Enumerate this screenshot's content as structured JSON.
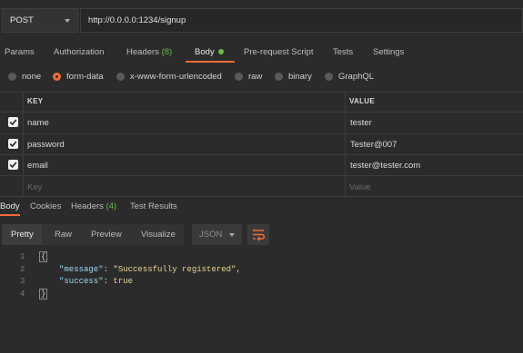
{
  "request": {
    "method": "POST",
    "url": "http://0.0.0.0:1234/signup"
  },
  "tabs": [
    {
      "label": "Params"
    },
    {
      "label": "Authorization"
    },
    {
      "label": "Headers",
      "count": "(8)"
    },
    {
      "label": "Body"
    },
    {
      "label": "Pre-request Script"
    },
    {
      "label": "Tests"
    },
    {
      "label": "Settings"
    }
  ],
  "body_modes": [
    {
      "label": "none",
      "selected": false
    },
    {
      "label": "form-data",
      "selected": true
    },
    {
      "label": "x-www-form-urlencoded",
      "selected": false
    },
    {
      "label": "raw",
      "selected": false
    },
    {
      "label": "binary",
      "selected": false
    },
    {
      "label": "GraphQL",
      "selected": false
    }
  ],
  "table": {
    "headers": {
      "key": "KEY",
      "value": "VALUE"
    },
    "rows": [
      {
        "key": "name",
        "value": "tester",
        "checked": true
      },
      {
        "key": "password",
        "value": "Tester@007",
        "checked": true
      },
      {
        "key": "email",
        "value": "tester@tester.com",
        "checked": true
      }
    ],
    "placeholder": {
      "key": "Key",
      "value": "Value"
    }
  },
  "response_tabs": [
    {
      "label": "Body"
    },
    {
      "label": "Cookies"
    },
    {
      "label": "Headers",
      "count": "(4)"
    },
    {
      "label": "Test Results"
    }
  ],
  "view_modes": [
    "Pretty",
    "Raw",
    "Preview",
    "Visualize"
  ],
  "format": "JSON",
  "code": {
    "line_numbers": [
      "1",
      "2",
      "3",
      "4"
    ],
    "open_brace": "{",
    "close_brace": "}",
    "message_key": "\"message\"",
    "message_value": "\"Successfully registered\"",
    "success_key": "\"success\"",
    "success_value": "true"
  },
  "colors": {
    "accent": "#f26b3a",
    "success": "#6dbb4a"
  },
  "icons": [
    "chevron-down-icon",
    "checkbox-icon",
    "wrap-lines-icon"
  ]
}
